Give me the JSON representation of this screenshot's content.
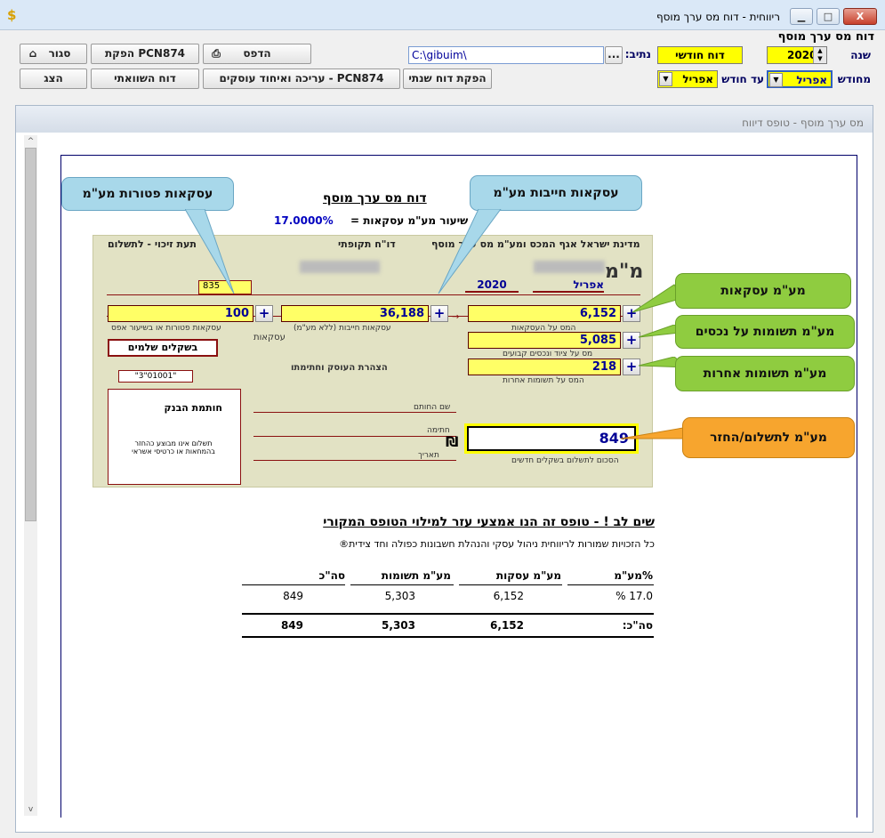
{
  "window": {
    "title": "ריווחית - דוח מס ערך מוסף",
    "app_icon": "dollar-icon",
    "min": "▭",
    "max": "□",
    "close": "X"
  },
  "toolbar": {
    "heading": "דוח מס ערך מוסף",
    "year_label": "שנה",
    "year_value": "2020",
    "from_month_label": "מחודש",
    "from_month_value": "אפריל",
    "to_month_label": "עד חודש",
    "to_month_value": "אפריל",
    "report_type": "דוח חודשי",
    "path_label": "נתיב:",
    "path_value": "C:\\gibuim\\",
    "browse": "...",
    "buttons": {
      "close": "סגור",
      "produce": "הפקת PCN874",
      "print": "הדפס",
      "show": "הצג",
      "compare": "דוח השוואתי",
      "edit_merge": "עריכה ואיחוד עוסקים - PCN874",
      "annual": "הפקת דוח שנתי"
    }
  },
  "panel": {
    "header": "מס ערך מוסף - טופס דיווח"
  },
  "doc": {
    "title": "דוח מס ערך מוסף",
    "rate_label": "שיעור מע\"מ עסקאות =",
    "rate_value": "17.0000%",
    "form": {
      "header_left": "מדינת ישראל אגף המכס ומע\"מ מס ערך מוסף",
      "header_mid": "דו\"ח תקופתי",
      "header_right": "תעת זיכוי - לתשלום",
      "month": "אפריל",
      "year": "2020",
      "mam_logo": "מ\"מ",
      "exempt_value": "100",
      "taxable_value": "36,188",
      "sales_vat": "6,152",
      "assets_vat": "5,085",
      "other_vat": "218",
      "total": "849",
      "code": "835",
      "shekel": "בשקלים שלמים",
      "bank_stamp": "חותמת הבנק",
      "declaration": "הצהרת העוסק וחתימתו",
      "ref": "\"3\"01001\"",
      "caption_exempt": "עסקאות פטורות או בשיעור אפס",
      "caption_taxable": "עסקאות חייבות (ללא מע\"מ)",
      "caption_sales": "המס על העסקאות",
      "caption_assets": "מס על ציוד ונכסים קבועים",
      "caption_other": "המס על תשומות אחרות",
      "caption_total": "הסכום לתשלום בשקלים חדשים",
      "deals": "עסקאות",
      "date": "תאריך",
      "signer": "שם החותם",
      "sign": "חתימה",
      "bank_note": "תשלום אינו מבוצע כהחזר\nבהמחאות או כרטיסי אשראי"
    },
    "callouts": {
      "exempt": "עסקאות פטורות מע\"מ",
      "taxable": "עסקאות חייבות מע\"מ",
      "sales": "מע\"מ עסקאות",
      "assets": "מע\"מ תשומות על נכסים",
      "other": "מע\"מ תשומות אחרות",
      "total": "מע\"מ לתשלום/החזר"
    },
    "note_title": "שים לב ! - טופס זה הנו אמצעי עזר למילוי הטופס המקורי",
    "copyright": "כל הזכויות שמורות לריווחית ניהול עסקי והנהלת חשבונות כפולה וחד צידית®",
    "summary": {
      "headers": [
        "%מע\"מ",
        "מע\"מ עסקות",
        "מע\"מ תשומות",
        "סה\"כ"
      ],
      "row": [
        "17.0 %",
        "6,152",
        "5,303",
        "849"
      ],
      "total_label": "סה\"כ:",
      "totals": [
        "6,152",
        "5,303",
        "849"
      ]
    }
  }
}
